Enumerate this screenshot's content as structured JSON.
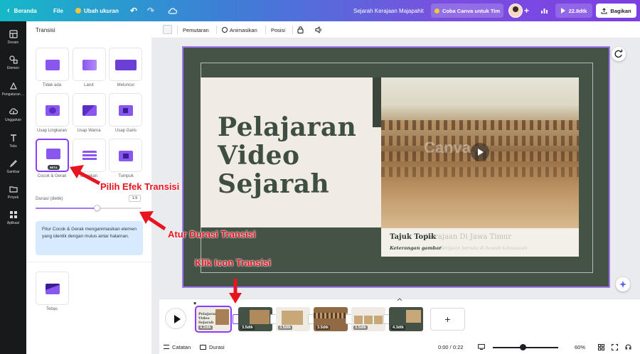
{
  "topbar": {
    "home_label": "Beranda",
    "file_label": "File",
    "resize_label": "Ubah ukuran",
    "doc_title": "Sejarah Kerajaan Majapahit",
    "try_team_label": "Coba Canva untuk Tim",
    "duration_label": "22.8dtk",
    "share_label": "Bagikan"
  },
  "rail": {
    "items": [
      {
        "label": "Desain",
        "icon": "layout-icon"
      },
      {
        "label": "Elemen",
        "icon": "shapes-icon"
      },
      {
        "label": "Pengaturan ...",
        "icon": "brand-icon"
      },
      {
        "label": "Unggahan",
        "icon": "upload-icon"
      },
      {
        "label": "Teks",
        "icon": "text-icon"
      },
      {
        "label": "Gambar",
        "icon": "draw-icon"
      },
      {
        "label": "Proyek",
        "icon": "folder-icon"
      },
      {
        "label": "Aplikasi",
        "icon": "apps-icon"
      }
    ]
  },
  "panel": {
    "title": "Transisi",
    "transitions": [
      {
        "label": "Tidak ada"
      },
      {
        "label": "Larut"
      },
      {
        "label": "Meluncur"
      },
      {
        "label": "Usap Lingkaran"
      },
      {
        "label": "Usap Warna"
      },
      {
        "label": "Usap Garis"
      },
      {
        "label": "Cocok & Gerak",
        "badge": "BETA",
        "selected": true
      },
      {
        "label": "Gesekan"
      },
      {
        "label": "Tumpuk"
      }
    ],
    "duration_label": "Durasi (detik)",
    "duration_value": "1.5",
    "duration_fraction": 0.58,
    "info_text": "Fitur Cocok & Gerak menganimasikan elemen yang identik dengan mulus antar halaman.",
    "extra_transition_label": "Tebas"
  },
  "context_toolbar": {
    "playback_label": "Pemutaran",
    "animate_label": "Animasikan",
    "position_label": "Posisi"
  },
  "slide": {
    "title_lines": [
      "Pelajaran",
      "Video",
      "Sejarah"
    ],
    "caption_title": "Tajuk Topik",
    "caption_ghost": "Kerajaan Di Jawa Timur",
    "caption_subtitle": "Keterangan gambar",
    "caption_ghost2": "Kerajaan berada di bawah kekuasaan",
    "watermark": "Canva"
  },
  "timeline": {
    "pages": [
      {
        "duration": "4.2dtk",
        "title": "Pelajaran Video Sejarah"
      },
      {
        "duration": "3.5dtk"
      },
      {
        "duration": "3.5dtk"
      },
      {
        "duration": "3.5dtk"
      },
      {
        "duration": "3.5dtk"
      },
      {
        "duration": "4.3dtk"
      }
    ],
    "add_label": "+"
  },
  "bottombar": {
    "notes_label": "Catatan",
    "duration_label": "Durasi",
    "time_readout": "0:00 / 0:22",
    "zoom_value": "60%",
    "zoom_fraction": 0.46
  },
  "annotations": {
    "pick_effect": "Pilih Efek Transisi",
    "set_duration": "Atur Durasi Transisi",
    "click_icon": "Klik Icon Transisi"
  },
  "colors": {
    "accent": "#8b3dff",
    "slide_bg": "#455347",
    "annotation": "#e8141f"
  }
}
